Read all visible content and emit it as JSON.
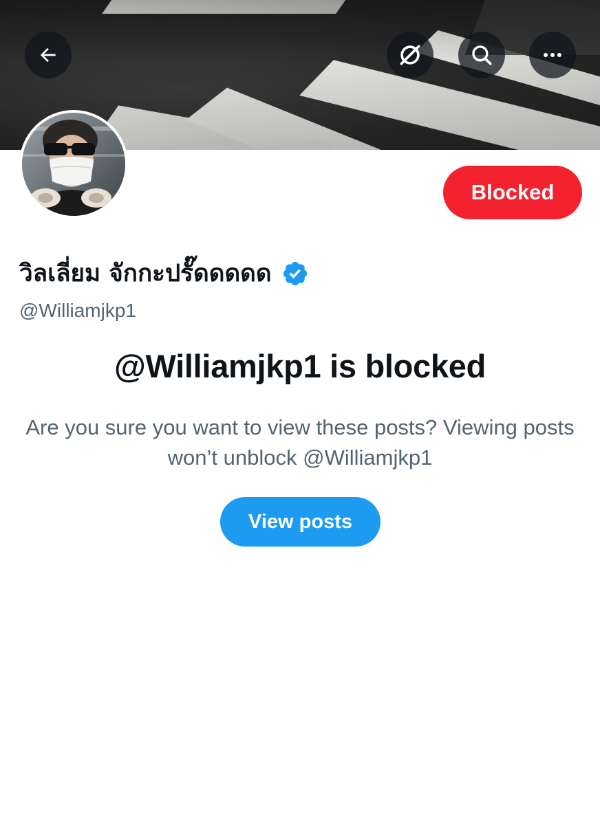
{
  "header": {
    "back_icon": "arrow-left-icon",
    "grok_icon": "grok-icon",
    "search_icon": "search-icon",
    "more_icon": "more-icon"
  },
  "profile": {
    "display_name": "วิลเลี่ยม จักกะปรั๊ดดดดด",
    "verified": true,
    "handle": "@Williamjkp1",
    "blocked_button_label": "Blocked"
  },
  "blocked_notice": {
    "title": "@Williamjkp1 is blocked",
    "description": "Are you sure you want to view these posts? Viewing posts won’t unblock @Williamjkp1",
    "view_posts_label": "View posts"
  },
  "colors": {
    "blocked_red": "#f4212e",
    "accent_blue": "#1d9bf0",
    "text_primary": "#0f1419",
    "text_secondary": "#536471"
  }
}
